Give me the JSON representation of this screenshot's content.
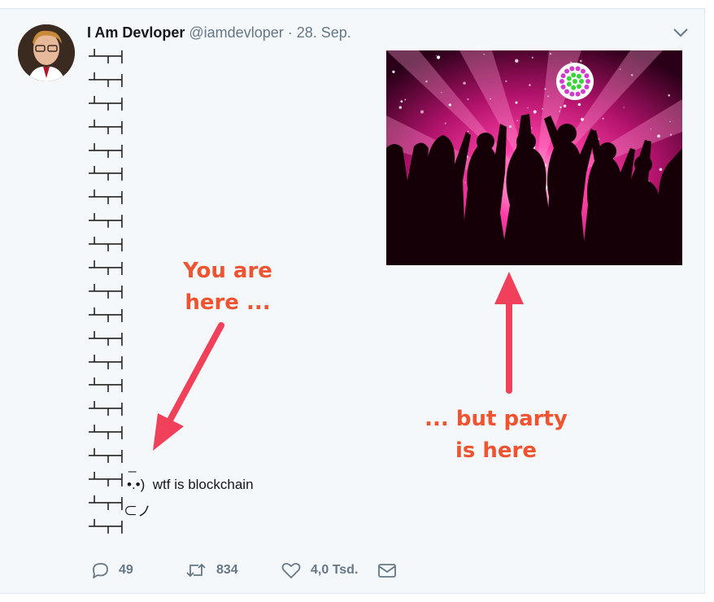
{
  "tweet": {
    "author_name": "I Am Devloper",
    "author_handle": "@iamdevloper",
    "separator": "·",
    "date": "28. Sep.",
    "face_text": "•.•)",
    "text": "wtf is blockchain",
    "hand_text": "⊂ノ",
    "dash_text": "_"
  },
  "annotations": {
    "you_are_here_line1": "You are",
    "you_are_here_line2": "here ...",
    "party_line1": "... but party",
    "party_line2": "is here",
    "color": "#f0532f"
  },
  "actions": {
    "reply_count": "49",
    "retweet_count": "834",
    "like_count": "4,0 Tsd."
  },
  "icons": [
    "chevron-down-icon",
    "reply-icon",
    "retweet-icon",
    "like-icon",
    "direct-message-icon"
  ]
}
